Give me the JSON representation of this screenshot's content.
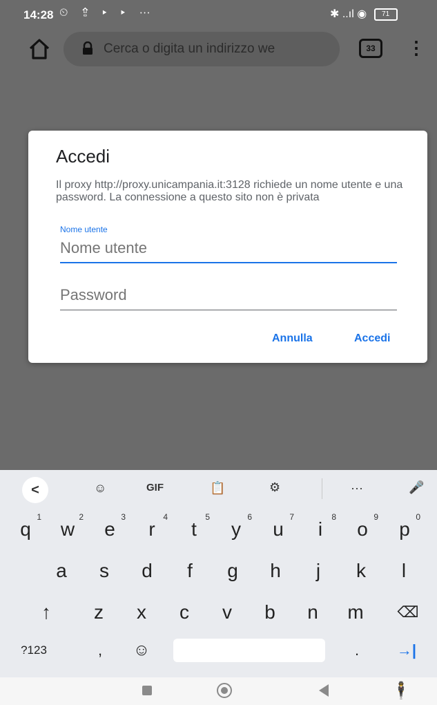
{
  "status_bar": {
    "time": "14:28",
    "left_icons": "⏲ ⇪ ▸ ▸ ⋯",
    "right_icons": "✱ ..ıl ◉",
    "battery": "71"
  },
  "toolbar": {
    "url_placeholder": "Cerca o digita un indirizzo we",
    "tab_count": "33"
  },
  "dialog": {
    "title": "Accedi",
    "message": "Il proxy http://proxy.unicampania.it:3128 richiede un nome utente e una password. La connessione a questo sito non è privata",
    "username_label": "Nome utente",
    "username_placeholder": "Nome utente",
    "password_placeholder": "Password",
    "cancel": "Annulla",
    "signin": "Accedi"
  },
  "keyboard": {
    "toolbar": [
      "<",
      "☺",
      "GIF",
      "📋",
      "⚙",
      "···",
      "🎤"
    ],
    "row1": [
      {
        "key": "q",
        "num": "1"
      },
      {
        "key": "w",
        "num": "2"
      },
      {
        "key": "e",
        "num": "3"
      },
      {
        "key": "r",
        "num": "4"
      },
      {
        "key": "t",
        "num": "5"
      },
      {
        "key": "y",
        "num": "6"
      },
      {
        "key": "u",
        "num": "7"
      },
      {
        "key": "i",
        "num": "8"
      },
      {
        "key": "o",
        "num": "9"
      },
      {
        "key": "p",
        "num": "0"
      }
    ],
    "row2": [
      "a",
      "s",
      "d",
      "f",
      "g",
      "h",
      "j",
      "k",
      "l"
    ],
    "row3": [
      "↑",
      "z",
      "x",
      "c",
      "v",
      "b",
      "n",
      "m",
      "⌫"
    ],
    "row4": {
      "symbols": "?123",
      "comma": ",",
      "emoji": "☺",
      "period": ".",
      "enter": "→|"
    }
  },
  "colors": {
    "accent": "#1a73e8",
    "scrim": "#6b6b6b",
    "keyboard_bg": "#e9ebef"
  }
}
